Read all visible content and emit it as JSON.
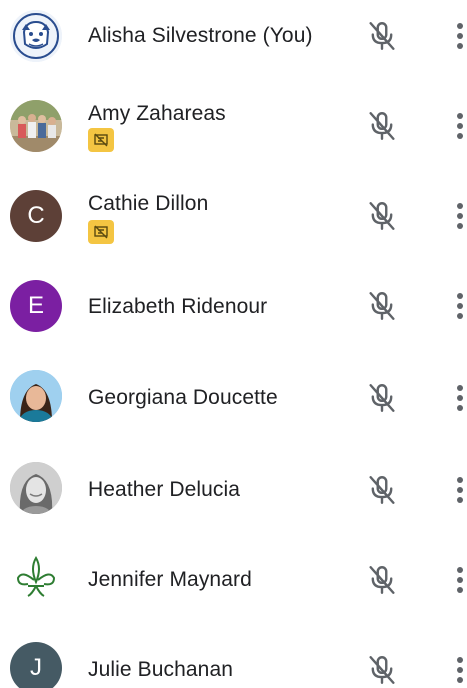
{
  "participants": [
    {
      "name": "Alisha Silvestrone (You)",
      "avatar_type": "image",
      "avatar_icon": "bulldog-logo",
      "has_badge": false
    },
    {
      "name": "Amy Zahareas",
      "avatar_type": "image",
      "avatar_icon": "family-photo",
      "has_badge": true
    },
    {
      "name": "Cathie Dillon",
      "avatar_type": "letter",
      "avatar_letter": "C",
      "avatar_color": "#5d4037",
      "has_badge": true
    },
    {
      "name": "Elizabeth Ridenour",
      "avatar_type": "letter",
      "avatar_letter": "E",
      "avatar_color": "#7b1fa2",
      "has_badge": false
    },
    {
      "name": "Georgiana Doucette",
      "avatar_type": "image",
      "avatar_icon": "portrait-photo",
      "has_badge": false
    },
    {
      "name": "Heather Delucia",
      "avatar_type": "image",
      "avatar_icon": "portrait-photo-bw",
      "has_badge": false
    },
    {
      "name": "Jennifer Maynard",
      "avatar_type": "image",
      "avatar_icon": "fleur-de-lis",
      "has_badge": false
    },
    {
      "name": "Julie Buchanan",
      "avatar_type": "letter",
      "avatar_letter": "J",
      "avatar_color": "#455a64",
      "has_badge": false
    }
  ],
  "icons": {
    "mic": "mic-off-icon",
    "more": "more-vert-icon",
    "badge": "presentation-off-icon"
  },
  "colors": {
    "text": "#202124",
    "icon": "#5f6368",
    "badge": "#f4c542"
  }
}
